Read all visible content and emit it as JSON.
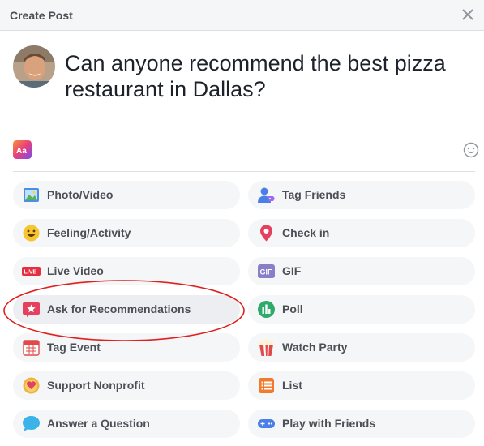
{
  "dialog": {
    "title": "Create Post"
  },
  "post": {
    "text": "Can anyone recommend the best pizza restaurant in Dallas?"
  },
  "background_button": {
    "icon": "aa-background-icon"
  },
  "options_left": [
    {
      "label": "Photo/Video",
      "icon": "photo-video-icon"
    },
    {
      "label": "Feeling/Activity",
      "icon": "feeling-smiley-icon"
    },
    {
      "label": "Live Video",
      "icon": "live-video-icon"
    },
    {
      "label": "Ask for Recommendations",
      "icon": "recommendation-star-icon"
    },
    {
      "label": "Tag Event",
      "icon": "calendar-icon"
    },
    {
      "label": "Support Nonprofit",
      "icon": "heart-medal-icon"
    },
    {
      "label": "Answer a Question",
      "icon": "speech-bubble-icon"
    }
  ],
  "options_right": [
    {
      "label": "Tag Friends",
      "icon": "tag-friends-icon"
    },
    {
      "label": "Check in",
      "icon": "location-pin-icon"
    },
    {
      "label": "GIF",
      "icon": "gif-icon"
    },
    {
      "label": "Poll",
      "icon": "poll-icon"
    },
    {
      "label": "Watch Party",
      "icon": "popcorn-icon"
    },
    {
      "label": "List",
      "icon": "list-icon"
    },
    {
      "label": "Play with Friends",
      "icon": "game-controller-icon"
    }
  ],
  "colors": {
    "header_bg": "#f5f6f7",
    "option_bg": "#f5f6f7",
    "annotation_red": "#e02020",
    "text": "#4b4f56"
  }
}
